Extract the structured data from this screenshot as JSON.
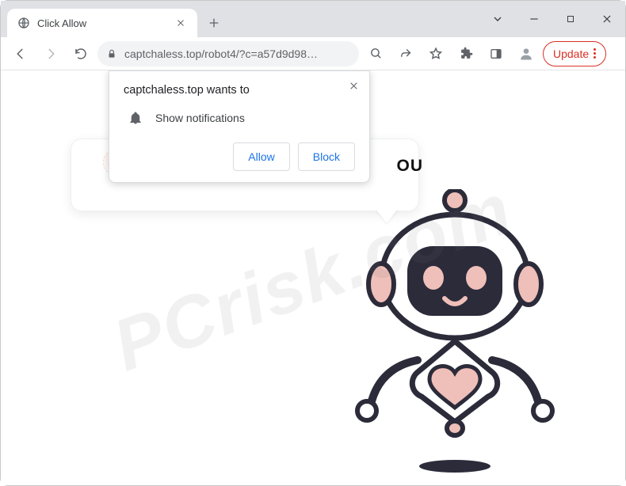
{
  "tab": {
    "title": "Click Allow"
  },
  "omnibox": {
    "url": "captchaless.top/robot4/?c=a57d9d98…"
  },
  "update_button": {
    "label": "Update"
  },
  "permission": {
    "heading": "captchaless.top wants to",
    "notif_label": "Show notifications",
    "allow": "Allow",
    "block": "Block"
  },
  "speech": {
    "hidden_text_fragment": "OU"
  },
  "watermark": "PCrisk.com",
  "icons": {
    "globe": "globe-icon",
    "close": "close-icon",
    "plus": "plus-icon",
    "chevron_down": "chevron-down-icon",
    "minimize": "minimize-icon",
    "maximize": "maximize-icon",
    "window_close": "window-close-icon",
    "back": "back-icon",
    "forward": "forward-icon",
    "reload": "reload-icon",
    "lock": "lock-icon",
    "zoom": "magnifier-icon",
    "share": "share-icon",
    "star": "star-icon",
    "extensions": "puzzle-icon",
    "side_panel": "side-panel-icon",
    "profile": "profile-icon",
    "bell": "bell-icon"
  },
  "colors": {
    "accent_blue": "#1a73e8",
    "danger_red": "#d93025",
    "robot_pink": "#efbfb9",
    "robot_face": "#2b2b3a"
  }
}
